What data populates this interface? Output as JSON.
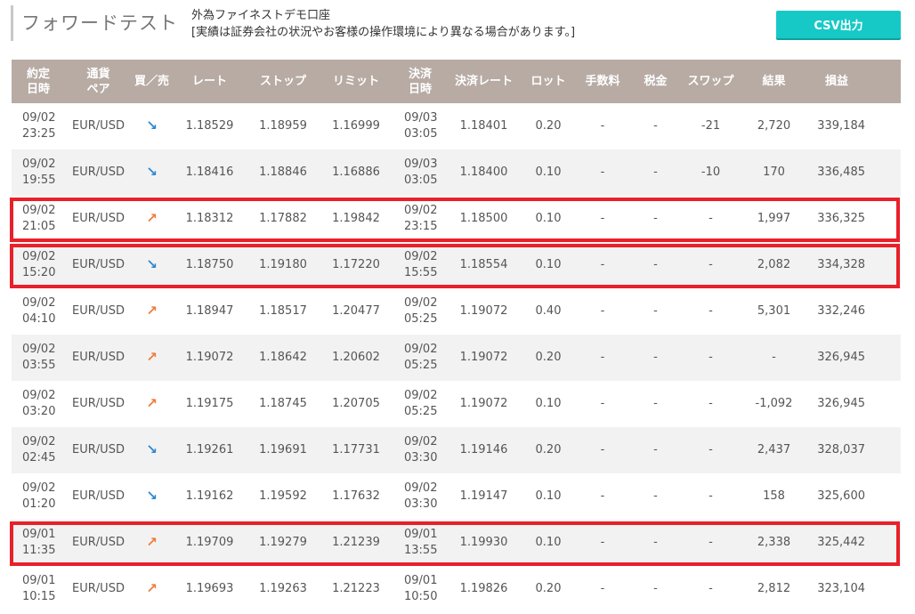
{
  "header": {
    "title": "フォワードテスト",
    "account_name": "外為ファイネストデモ口座",
    "disclaimer": "[実績は証券会社の状況やお客様の操作環境により異なる場合があります。]",
    "csv_button": "CSV出力"
  },
  "colors": {
    "header_bg": "#b7aba4",
    "csv_button": "#17c9c6",
    "sell_arrow": "#2b87d1",
    "buy_arrow": "#f07a3a",
    "highlight_box": "#e8202a",
    "alt_row": "#f2f2f2"
  },
  "table": {
    "columns": [
      {
        "l1": "約定",
        "l2": "日時"
      },
      {
        "l1": "通貨",
        "l2": "ペア"
      },
      {
        "l1": "買／売",
        "l2": ""
      },
      {
        "l1": "レート",
        "l2": ""
      },
      {
        "l1": "ストップ",
        "l2": ""
      },
      {
        "l1": "リミット",
        "l2": ""
      },
      {
        "l1": "決済",
        "l2": "日時"
      },
      {
        "l1": "決済レート",
        "l2": ""
      },
      {
        "l1": "ロット",
        "l2": ""
      },
      {
        "l1": "手数料",
        "l2": ""
      },
      {
        "l1": "税金",
        "l2": ""
      },
      {
        "l1": "スワップ",
        "l2": ""
      },
      {
        "l1": "結果",
        "l2": ""
      },
      {
        "l1": "損益",
        "l2": ""
      }
    ],
    "rows": [
      {
        "open_date": "09/02",
        "open_time": "23:25",
        "pair": "EUR/USD",
        "side": "sell",
        "arrow": "↘",
        "rate": "1.18529",
        "stop": "1.18959",
        "limit": "1.16999",
        "close_date": "09/03",
        "close_time": "03:05",
        "close_rate": "1.18401",
        "lot": "0.20",
        "fee": "-",
        "tax": "-",
        "swap": "-21",
        "result": "2,720",
        "pnl": "339,184",
        "highlighted": false
      },
      {
        "open_date": "09/02",
        "open_time": "19:55",
        "pair": "EUR/USD",
        "side": "sell",
        "arrow": "↘",
        "rate": "1.18416",
        "stop": "1.18846",
        "limit": "1.16886",
        "close_date": "09/03",
        "close_time": "03:05",
        "close_rate": "1.18400",
        "lot": "0.10",
        "fee": "-",
        "tax": "-",
        "swap": "-10",
        "result": "170",
        "pnl": "336,485",
        "highlighted": false
      },
      {
        "open_date": "09/02",
        "open_time": "21:05",
        "pair": "EUR/USD",
        "side": "buy",
        "arrow": "↗",
        "rate": "1.18312",
        "stop": "1.17882",
        "limit": "1.19842",
        "close_date": "09/02",
        "close_time": "23:15",
        "close_rate": "1.18500",
        "lot": "0.10",
        "fee": "-",
        "tax": "-",
        "swap": "-",
        "result": "1,997",
        "pnl": "336,325",
        "highlighted": true
      },
      {
        "open_date": "09/02",
        "open_time": "15:20",
        "pair": "EUR/USD",
        "side": "sell",
        "arrow": "↘",
        "rate": "1.18750",
        "stop": "1.19180",
        "limit": "1.17220",
        "close_date": "09/02",
        "close_time": "15:55",
        "close_rate": "1.18554",
        "lot": "0.10",
        "fee": "-",
        "tax": "-",
        "swap": "-",
        "result": "2,082",
        "pnl": "334,328",
        "highlighted": true
      },
      {
        "open_date": "09/02",
        "open_time": "04:10",
        "pair": "EUR/USD",
        "side": "buy",
        "arrow": "↗",
        "rate": "1.18947",
        "stop": "1.18517",
        "limit": "1.20477",
        "close_date": "09/02",
        "close_time": "05:25",
        "close_rate": "1.19072",
        "lot": "0.40",
        "fee": "-",
        "tax": "-",
        "swap": "-",
        "result": "5,301",
        "pnl": "332,246",
        "highlighted": false
      },
      {
        "open_date": "09/02",
        "open_time": "03:55",
        "pair": "EUR/USD",
        "side": "buy",
        "arrow": "↗",
        "rate": "1.19072",
        "stop": "1.18642",
        "limit": "1.20602",
        "close_date": "09/02",
        "close_time": "05:25",
        "close_rate": "1.19072",
        "lot": "0.20",
        "fee": "-",
        "tax": "-",
        "swap": "-",
        "result": "-",
        "pnl": "326,945",
        "highlighted": false
      },
      {
        "open_date": "09/02",
        "open_time": "03:20",
        "pair": "EUR/USD",
        "side": "buy",
        "arrow": "↗",
        "rate": "1.19175",
        "stop": "1.18745",
        "limit": "1.20705",
        "close_date": "09/02",
        "close_time": "05:25",
        "close_rate": "1.19072",
        "lot": "0.10",
        "fee": "-",
        "tax": "-",
        "swap": "-",
        "result": "-1,092",
        "pnl": "326,945",
        "highlighted": false
      },
      {
        "open_date": "09/02",
        "open_time": "02:45",
        "pair": "EUR/USD",
        "side": "sell",
        "arrow": "↘",
        "rate": "1.19261",
        "stop": "1.19691",
        "limit": "1.17731",
        "close_date": "09/02",
        "close_time": "03:30",
        "close_rate": "1.19146",
        "lot": "0.20",
        "fee": "-",
        "tax": "-",
        "swap": "-",
        "result": "2,437",
        "pnl": "328,037",
        "highlighted": false
      },
      {
        "open_date": "09/02",
        "open_time": "01:20",
        "pair": "EUR/USD",
        "side": "sell",
        "arrow": "↘",
        "rate": "1.19162",
        "stop": "1.19592",
        "limit": "1.17632",
        "close_date": "09/02",
        "close_time": "03:30",
        "close_rate": "1.19147",
        "lot": "0.10",
        "fee": "-",
        "tax": "-",
        "swap": "-",
        "result": "158",
        "pnl": "325,600",
        "highlighted": false
      },
      {
        "open_date": "09/01",
        "open_time": "11:35",
        "pair": "EUR/USD",
        "side": "buy",
        "arrow": "↗",
        "rate": "1.19709",
        "stop": "1.19279",
        "limit": "1.21239",
        "close_date": "09/01",
        "close_time": "13:55",
        "close_rate": "1.19930",
        "lot": "0.10",
        "fee": "-",
        "tax": "-",
        "swap": "-",
        "result": "2,338",
        "pnl": "325,442",
        "highlighted": true
      },
      {
        "open_date": "09/01",
        "open_time": "10:15",
        "pair": "EUR/USD",
        "side": "buy",
        "arrow": "↗",
        "rate": "1.19693",
        "stop": "1.19263",
        "limit": "1.21223",
        "close_date": "09/01",
        "close_time": "10:50",
        "close_rate": "1.19826",
        "lot": "0.20",
        "fee": "-",
        "tax": "-",
        "swap": "-",
        "result": "2,812",
        "pnl": "323,104",
        "highlighted": false
      }
    ]
  }
}
